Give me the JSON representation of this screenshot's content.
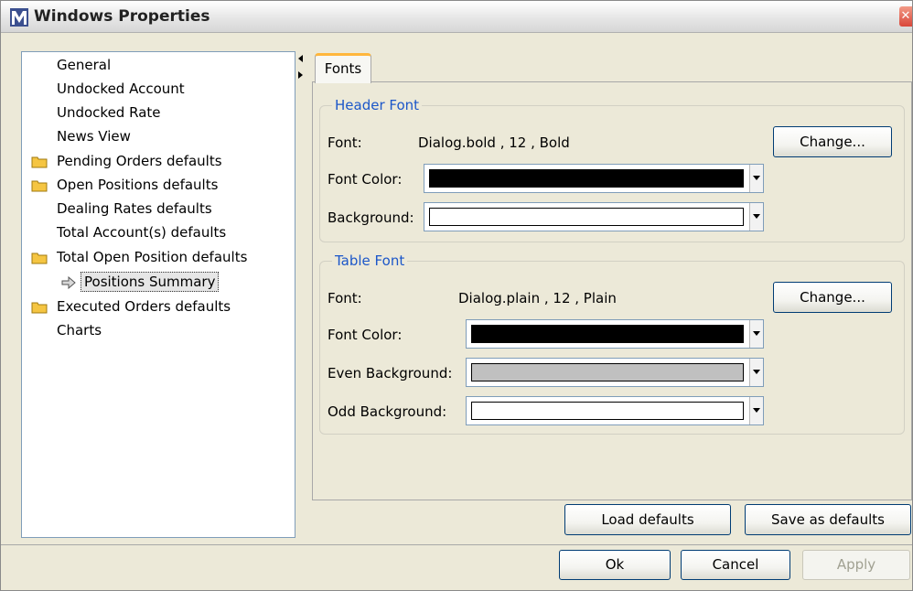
{
  "window": {
    "title": "Windows Properties",
    "close_glyph": "✕"
  },
  "tree": {
    "items": [
      {
        "label": "General",
        "folder": false
      },
      {
        "label": "Undocked Account",
        "folder": false
      },
      {
        "label": "Undocked Rate",
        "folder": false
      },
      {
        "label": "News View",
        "folder": false
      },
      {
        "label": "Pending Orders defaults",
        "folder": true
      },
      {
        "label": "Open Positions defaults",
        "folder": true
      },
      {
        "label": "Dealing Rates defaults",
        "folder": false
      },
      {
        "label": "Total Account(s) defaults",
        "folder": false
      },
      {
        "label": "Total Open Position defaults",
        "folder": true
      },
      {
        "label": "Positions Summary",
        "folder": false,
        "selected": true
      },
      {
        "label": "Executed Orders defaults",
        "folder": true
      },
      {
        "label": "Charts",
        "folder": false
      }
    ]
  },
  "tabs": [
    {
      "label": "Fonts",
      "active": true
    }
  ],
  "header_font": {
    "title": "Header Font",
    "font_label": "Font:",
    "font_value": "Dialog.bold , 12 , Bold",
    "change_label": "Change...",
    "font_color_label": "Font Color:",
    "font_color": "#000000",
    "background_label": "Background:",
    "background_color": "#ffffff"
  },
  "table_font": {
    "title": "Table Font",
    "font_label": "Font:",
    "font_value": "Dialog.plain , 12 , Plain",
    "change_label": "Change...",
    "font_color_label": "Font Color:",
    "font_color": "#000000",
    "even_bg_label": "Even Background:",
    "even_bg_color": "#c0c0c0",
    "odd_bg_label": "Odd Background:",
    "odd_bg_color": "#ffffff"
  },
  "actions": {
    "load_defaults": "Load defaults",
    "save_defaults": "Save as defaults",
    "ok": "Ok",
    "cancel": "Cancel",
    "apply": "Apply"
  },
  "colors": {
    "accent_title": "#1c57c9",
    "tab_highlight": "#ffb63c",
    "folder": "#f5c542"
  }
}
